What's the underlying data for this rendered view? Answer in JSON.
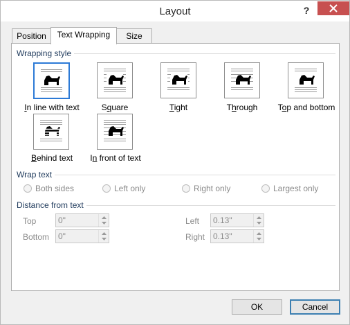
{
  "window": {
    "title": "Layout",
    "help_glyph": "?"
  },
  "tabs": [
    {
      "label": "Position"
    },
    {
      "label": "Text Wrapping",
      "active": true
    },
    {
      "label": "Size"
    }
  ],
  "wrapping_style": {
    "heading": "Wrapping style",
    "options": [
      {
        "pre": "",
        "ul": "I",
        "post": "n line with text",
        "selected": true
      },
      {
        "pre": "S",
        "ul": "q",
        "post": "uare"
      },
      {
        "pre": "",
        "ul": "T",
        "post": "ight"
      },
      {
        "pre": "T",
        "ul": "h",
        "post": "rough"
      },
      {
        "pre": "T",
        "ul": "o",
        "post": "p and bottom"
      },
      {
        "pre": "",
        "ul": "B",
        "post": "ehind text"
      },
      {
        "pre": "I",
        "ul": "n",
        "post": " front of text"
      }
    ]
  },
  "wrap_text": {
    "heading": "Wrap text",
    "options": [
      "Both sides",
      "Left only",
      "Right only",
      "Largest only"
    ]
  },
  "distance": {
    "heading": "Distance from text",
    "top": {
      "label": "Top",
      "value": "0\""
    },
    "bottom": {
      "label": "Bottom",
      "value": "0\""
    },
    "left": {
      "label": "Left",
      "value": "0.13\""
    },
    "right": {
      "label": "Right",
      "value": "0.13\""
    }
  },
  "buttons": {
    "ok": "OK",
    "cancel": "Cancel"
  },
  "colors": {
    "selected_border": "#2c7ad6",
    "close_button": "#c75050",
    "section_heading": "#1e395b"
  }
}
